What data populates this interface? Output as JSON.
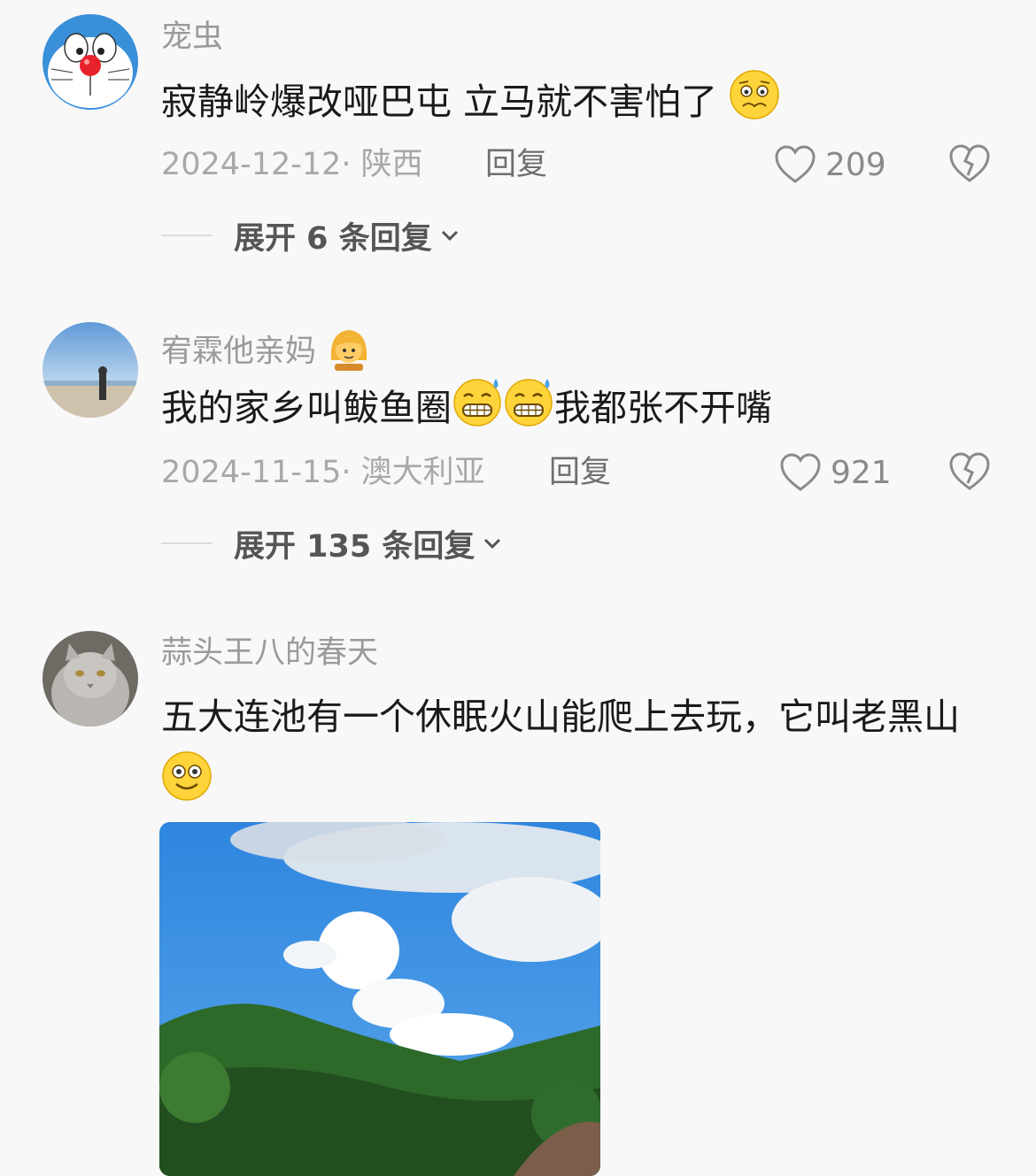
{
  "comments": [
    {
      "username": "宠虫",
      "text": "寂静岭爆改哑巴屯 立马就不害怕了",
      "date_location": "2024-12-12· 陕西",
      "reply_label": "回复",
      "likes": "209",
      "expand_label": "展开 6 条回复"
    },
    {
      "username": "宥霖他亲妈",
      "text_a": "我的家乡叫鲅鱼圈",
      "text_b": "我都张不开嘴",
      "date_location": "2024-11-15· 澳大利亚",
      "reply_label": "回复",
      "likes": "921",
      "expand_label": "展开 135 条回复"
    },
    {
      "username": "蒜头王八的春天",
      "text": "五大连池有一个休眠火山能爬上去玩，它叫老黑山"
    }
  ],
  "colors": {
    "background": "#f8f8f8",
    "username": "#9a9a9a",
    "text": "#1a1a1a",
    "meta": "#a8a8a8",
    "sky": "#2f86df"
  }
}
